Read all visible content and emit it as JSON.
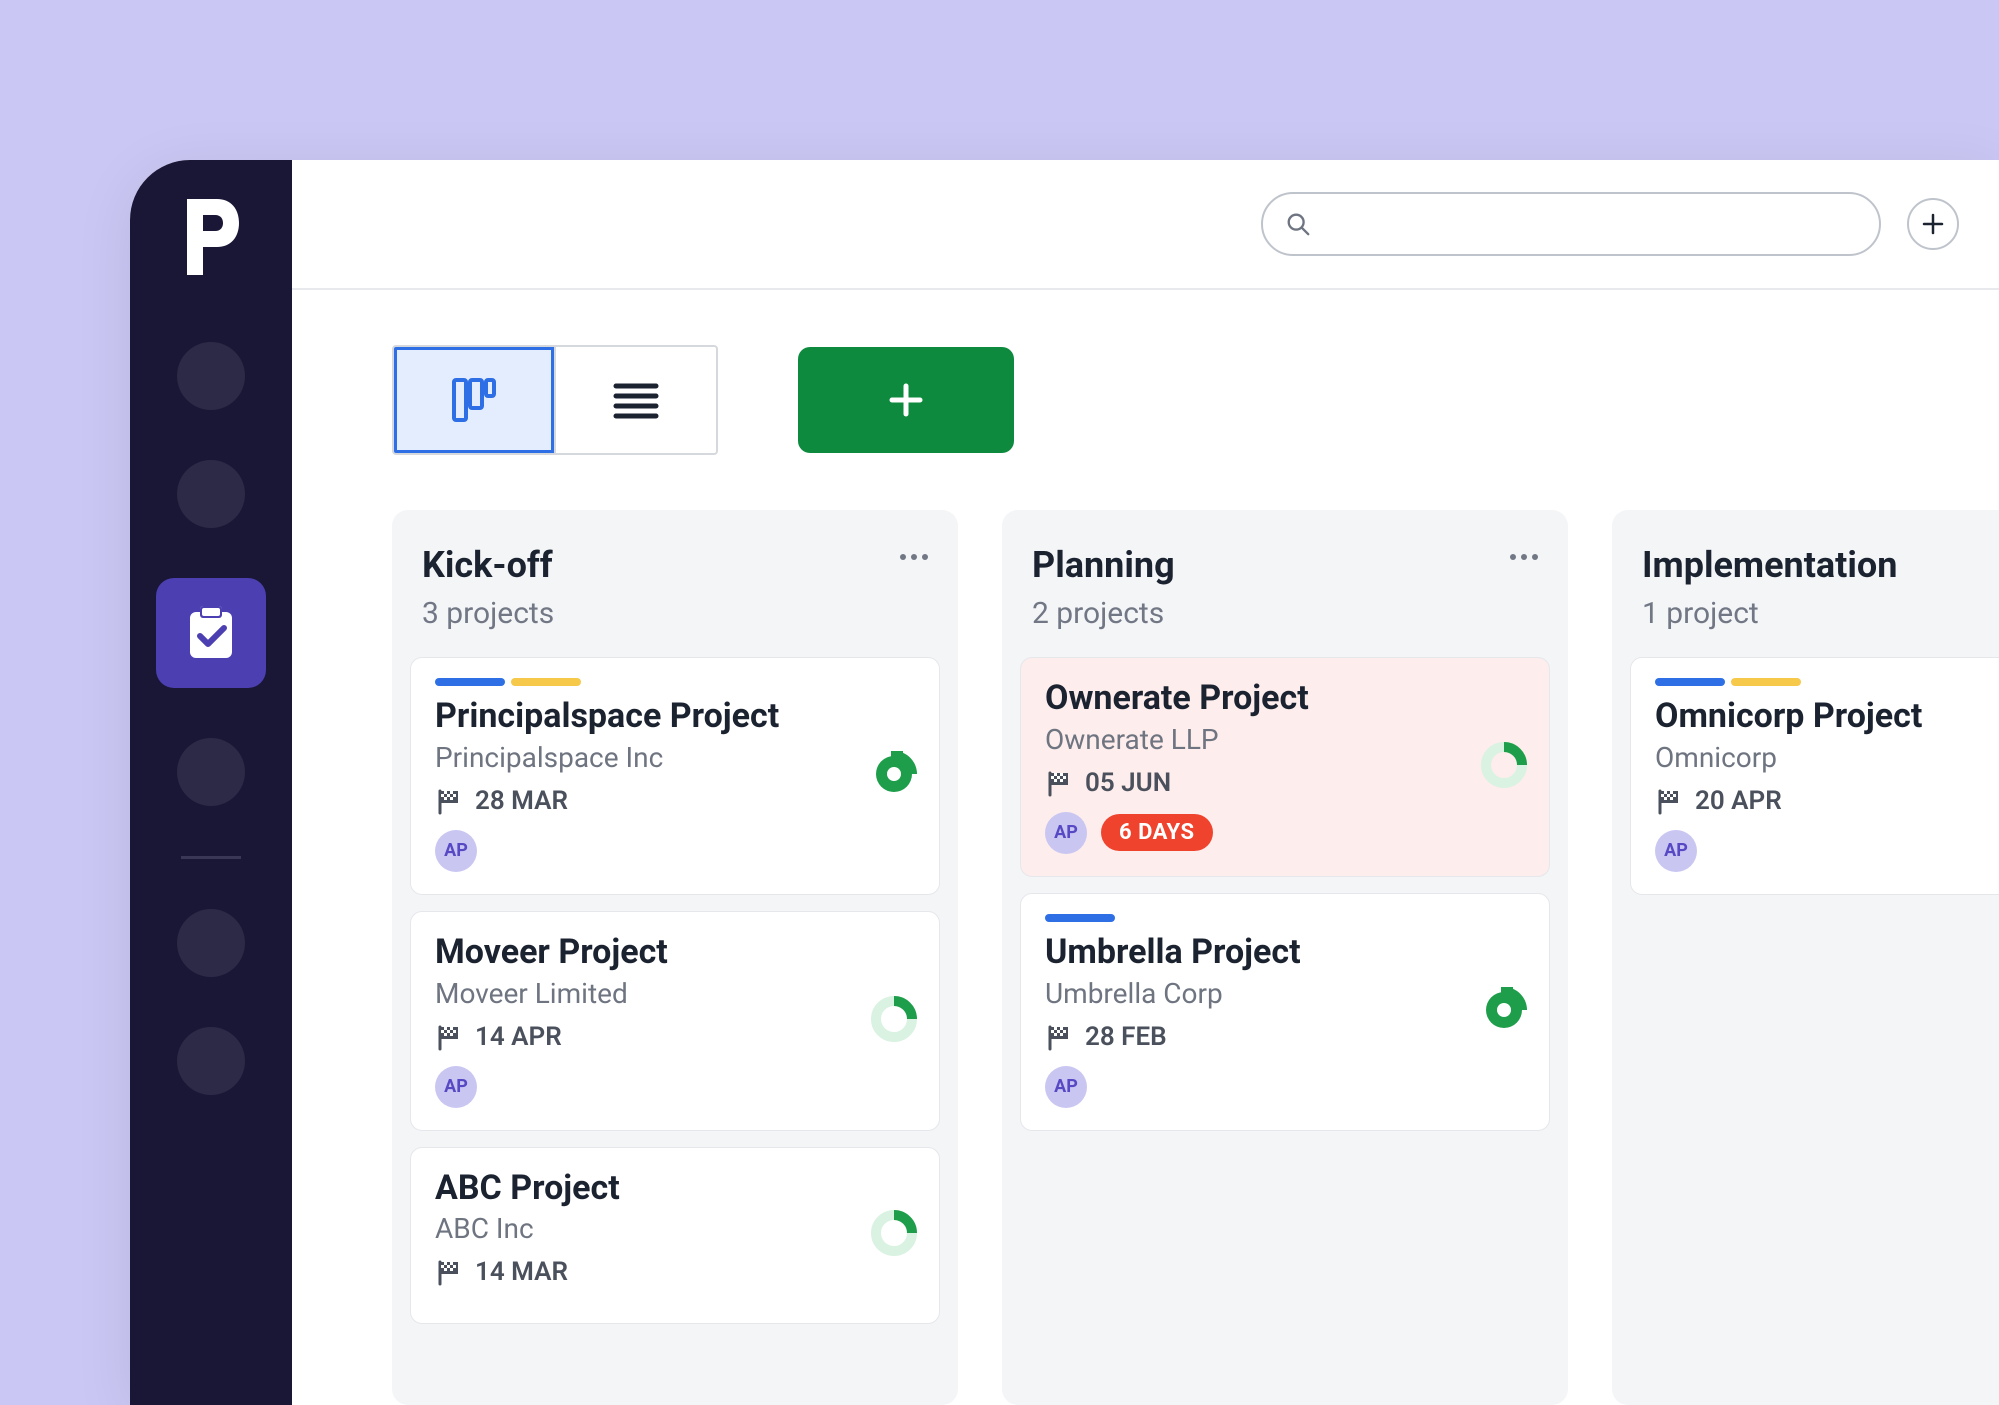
{
  "sidebar": {
    "logo_letter": "p"
  },
  "search": {
    "placeholder": ""
  },
  "columns": [
    {
      "title": "Kick-off",
      "subtitle": "3 projects",
      "has_menu": true,
      "cards": [
        {
          "stripes": [
            "blue",
            "yellow"
          ],
          "title": "Principalspace Project",
          "company": "Principalspace Inc",
          "date": "28 MAR",
          "avatar": "AP",
          "badge": "",
          "alert": false,
          "donut": "full"
        },
        {
          "stripes": [],
          "title": "Moveer Project",
          "company": "Moveer Limited",
          "date": "14 APR",
          "avatar": "AP",
          "badge": "",
          "alert": false,
          "donut": "half"
        },
        {
          "stripes": [],
          "title": "ABC Project",
          "company": "ABC Inc",
          "date": "14 MAR",
          "avatar": "",
          "badge": "",
          "alert": false,
          "donut": "half"
        }
      ]
    },
    {
      "title": "Planning",
      "subtitle": "2 projects",
      "has_menu": true,
      "cards": [
        {
          "stripes": [],
          "title": "Ownerate Project",
          "company": "Ownerate LLP",
          "date": "05 JUN",
          "avatar": "AP",
          "badge": "6 DAYS",
          "alert": true,
          "donut": "half"
        },
        {
          "stripes": [
            "blue"
          ],
          "title": "Umbrella Project",
          "company": "Umbrella Corp",
          "date": "28 FEB",
          "avatar": "AP",
          "badge": "",
          "alert": false,
          "donut": "full"
        }
      ]
    },
    {
      "title": "Implementation",
      "subtitle": "1 project",
      "has_menu": false,
      "cards": [
        {
          "stripes": [
            "blue",
            "yellow"
          ],
          "title": "Omnicorp Project",
          "company": "Omnicorp",
          "date": "20 APR",
          "avatar": "AP",
          "badge": "",
          "alert": false,
          "donut": ""
        }
      ]
    }
  ]
}
